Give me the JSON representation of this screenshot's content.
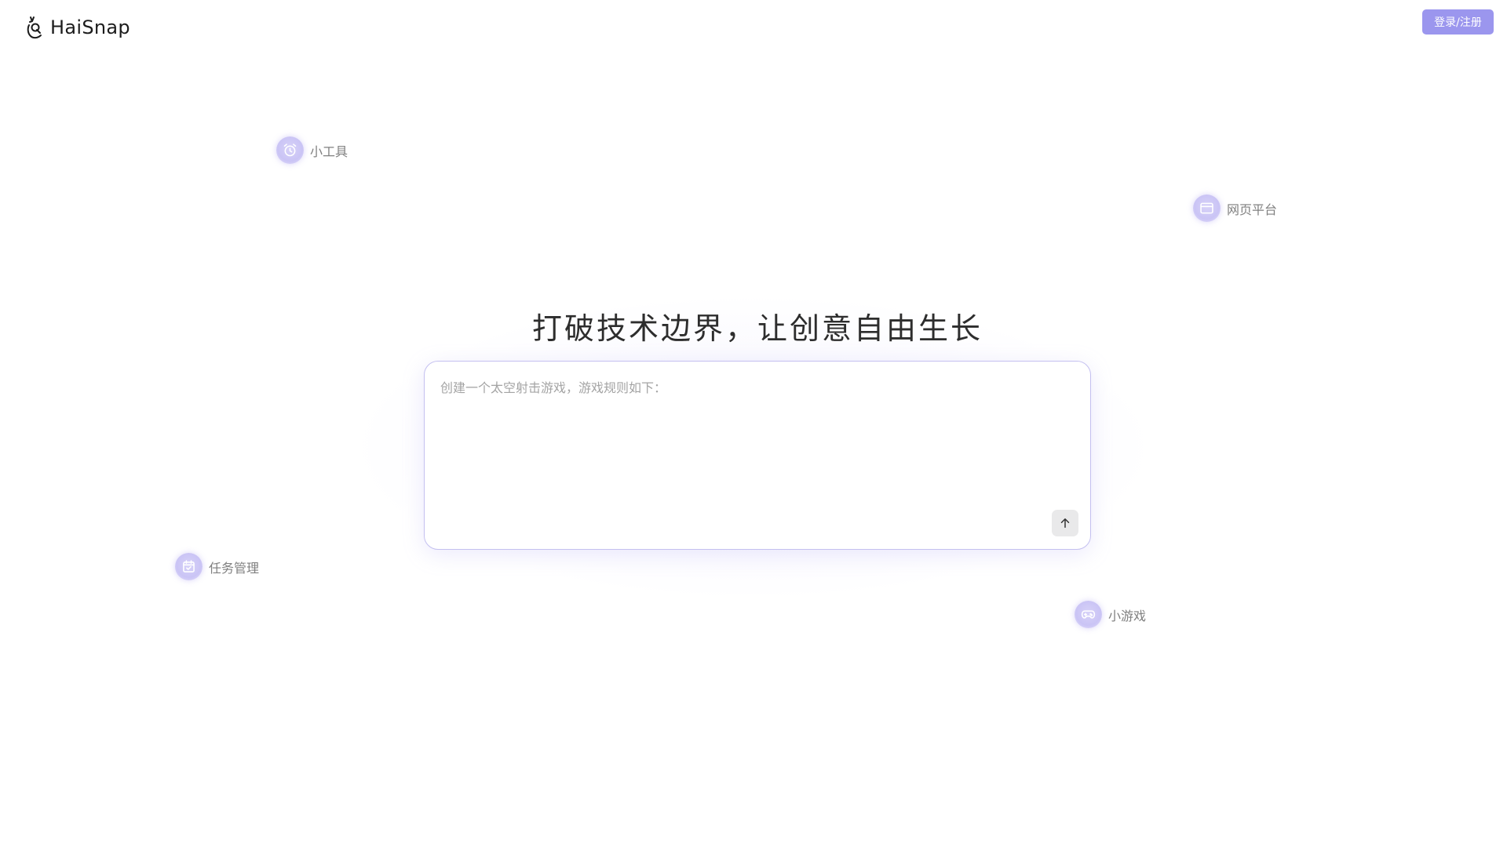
{
  "header": {
    "brand_name": "HaiSnap",
    "login_label": "登录/注册"
  },
  "categories": [
    {
      "label": "小工具",
      "icon": "alarm-clock-icon"
    },
    {
      "label": "网页平台",
      "icon": "browser-window-icon"
    },
    {
      "label": "任务管理",
      "icon": "calendar-check-icon"
    },
    {
      "label": "小游戏",
      "icon": "gamepad-icon"
    }
  ],
  "main": {
    "headline": "打破技术边界，让创意自由生长",
    "prompt_placeholder": "创建一个太空射击游戏，游戏规则如下：",
    "prompt_value": "",
    "send_icon": "arrow-up-icon"
  },
  "colors": {
    "accent": "#9b96ee",
    "chip_bg": "#cac4f5",
    "border": "#c4c0f0"
  }
}
